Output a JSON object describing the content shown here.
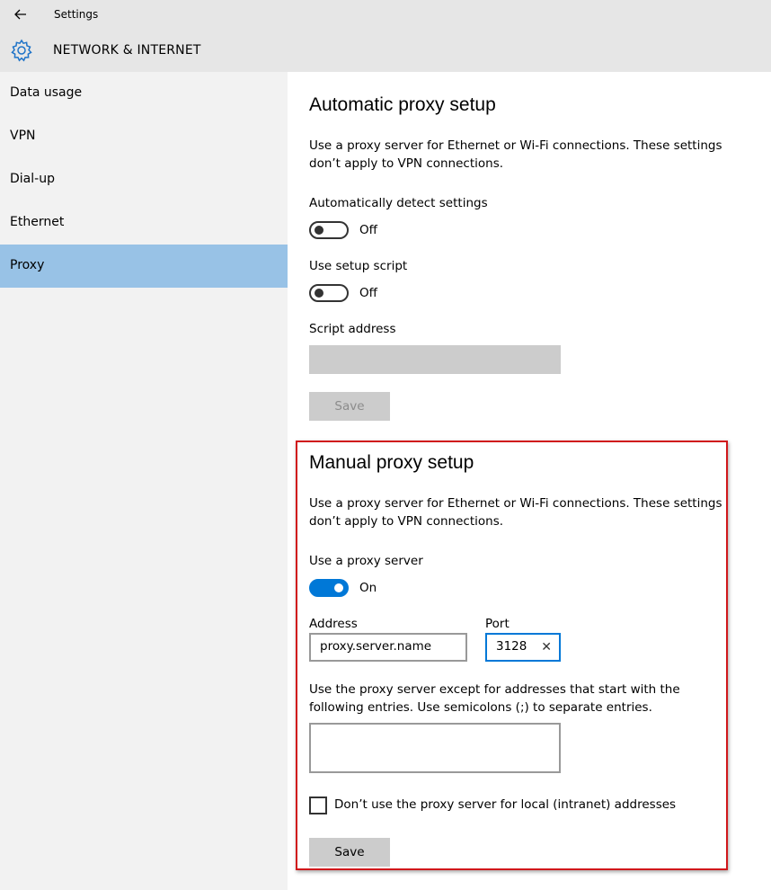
{
  "window": {
    "title": "Settings"
  },
  "header": {
    "title": "NETWORK & INTERNET"
  },
  "sidebar": {
    "items": [
      {
        "label": "Data usage"
      },
      {
        "label": "VPN"
      },
      {
        "label": "Dial-up"
      },
      {
        "label": "Ethernet"
      },
      {
        "label": "Proxy"
      }
    ],
    "active": "Proxy"
  },
  "automatic": {
    "title": "Automatic proxy setup",
    "description": "Use a proxy server for Ethernet or Wi-Fi connections. These settings don’t apply to VPN connections.",
    "detect_label": "Automatically detect settings",
    "detect_state": "Off",
    "script_label": "Use setup script",
    "script_state": "Off",
    "address_label": "Script address",
    "save_label": "Save"
  },
  "manual": {
    "title": "Manual proxy setup",
    "description": "Use a proxy server for Ethernet or Wi-Fi connections. These settings don’t apply to VPN connections.",
    "use_proxy_label": "Use a proxy server",
    "use_proxy_state": "On",
    "address_label": "Address",
    "address_value": "proxy.server.name",
    "port_label": "Port",
    "port_value": "3128",
    "exceptions_text": "Use the proxy server except for addresses that start with the following entries. Use semicolons (;) to separate entries.",
    "exceptions_value": "",
    "local_checkbox_label": "Don’t use the proxy server for local (intranet) addresses",
    "save_label": "Save"
  },
  "colors": {
    "accent": "#0078d7",
    "sidebar_active": "#98c2e6",
    "highlight_border": "#d0171b"
  }
}
